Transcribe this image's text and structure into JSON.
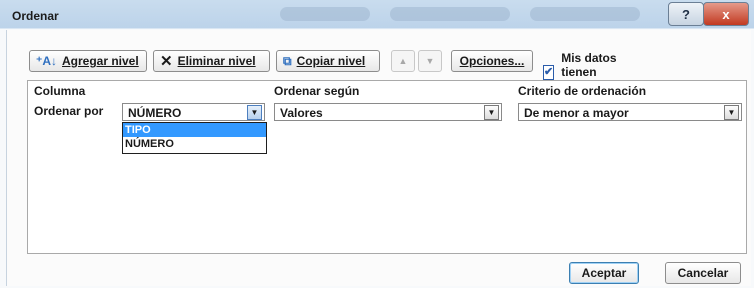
{
  "window": {
    "title": "Ordenar",
    "help_label": "?",
    "close_label": "x"
  },
  "toolbar": {
    "add_level": "Agregar nivel",
    "delete_level": "Eliminar nivel",
    "copy_level": "Copiar nivel",
    "move_up": "▲",
    "move_down": "▼",
    "options": "Opciones...",
    "headers_checkbox": {
      "label": "Mis datos tienen encabezados",
      "checked": true
    }
  },
  "grid": {
    "columns": [
      "Columna",
      "Ordenar según",
      "Criterio de ordenación"
    ],
    "row": {
      "label": "Ordenar por",
      "column_value": "NÚMERO",
      "sort_on_value": "Valores",
      "order_value": "De menor a mayor"
    },
    "dropdown_options": [
      "TIPO",
      "NÚMERO"
    ],
    "dropdown_selected": "TIPO"
  },
  "footer": {
    "ok": "Aceptar",
    "cancel": "Cancelar"
  },
  "colors": {
    "title_bar": "#bcd3ea",
    "selection": "#3399ff",
    "close_button": "#c23a22"
  }
}
